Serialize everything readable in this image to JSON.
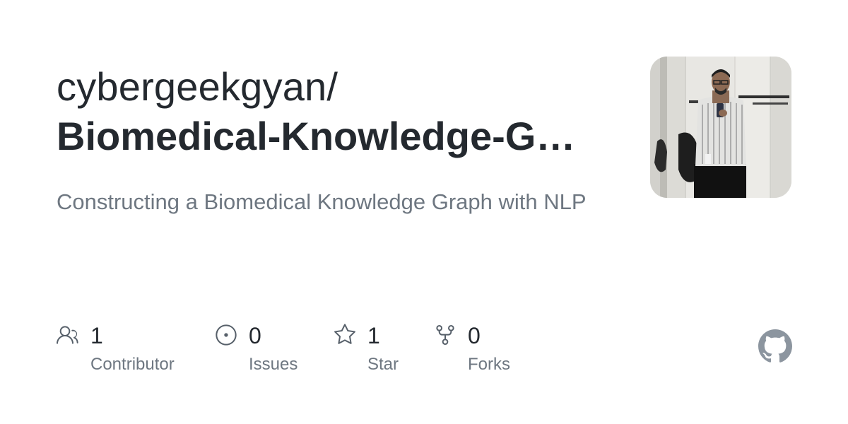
{
  "repo_card": {
    "owner": "cybergeekgyan/",
    "repo_name": "Biomedical-Knowledge-Graph-Construction",
    "description": "Constructing a Biomedical Knowledge Graph with NLP",
    "stats": {
      "contributors": {
        "count": "1",
        "label": "Contributor",
        "icon": "people-icon"
      },
      "issues": {
        "count": "0",
        "label": "Issues",
        "icon": "issue-opened-icon"
      },
      "stars": {
        "count": "1",
        "label": "Star",
        "icon": "star-icon"
      },
      "forks": {
        "count": "0",
        "label": "Forks",
        "icon": "repo-forked-icon"
      }
    },
    "colors": {
      "text_primary": "#24292f",
      "text_secondary": "#6e7781",
      "icon": "#57606a",
      "github_logo": "#8c959f"
    }
  }
}
